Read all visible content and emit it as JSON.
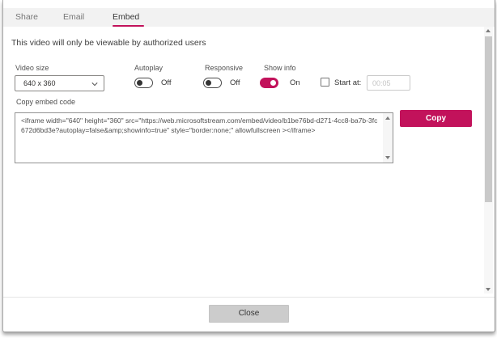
{
  "colors": {
    "accent": "#C2125B"
  },
  "tabs": [
    {
      "label": "Share",
      "active": false
    },
    {
      "label": "Email",
      "active": false
    },
    {
      "label": "Embed",
      "active": true
    }
  ],
  "notice": "This video will only be viewable by authorized users",
  "controls": {
    "video_size": {
      "label": "Video size",
      "value": "640 x 360"
    },
    "autoplay": {
      "label": "Autoplay",
      "state": "Off",
      "on": false
    },
    "responsive": {
      "label": "Responsive",
      "state": "Off",
      "on": false
    },
    "show_info": {
      "label": "Show info",
      "state": "On",
      "on": true
    },
    "start_at": {
      "label": "Start at:",
      "checked": false,
      "value": "00:05"
    }
  },
  "embed": {
    "label": "Copy embed code",
    "code": "<iframe width=\"640\" height=\"360\" src=\"https://web.microsoftstream.com/embed/video/b1be76bd-d271-4cc8-ba7b-3fc672d6bd3e?autoplay=false&amp;showinfo=true\" style=\"border:none;\" allowfullscreen ></iframe>",
    "copy_label": "Copy"
  },
  "footer": {
    "close_label": "Close"
  }
}
